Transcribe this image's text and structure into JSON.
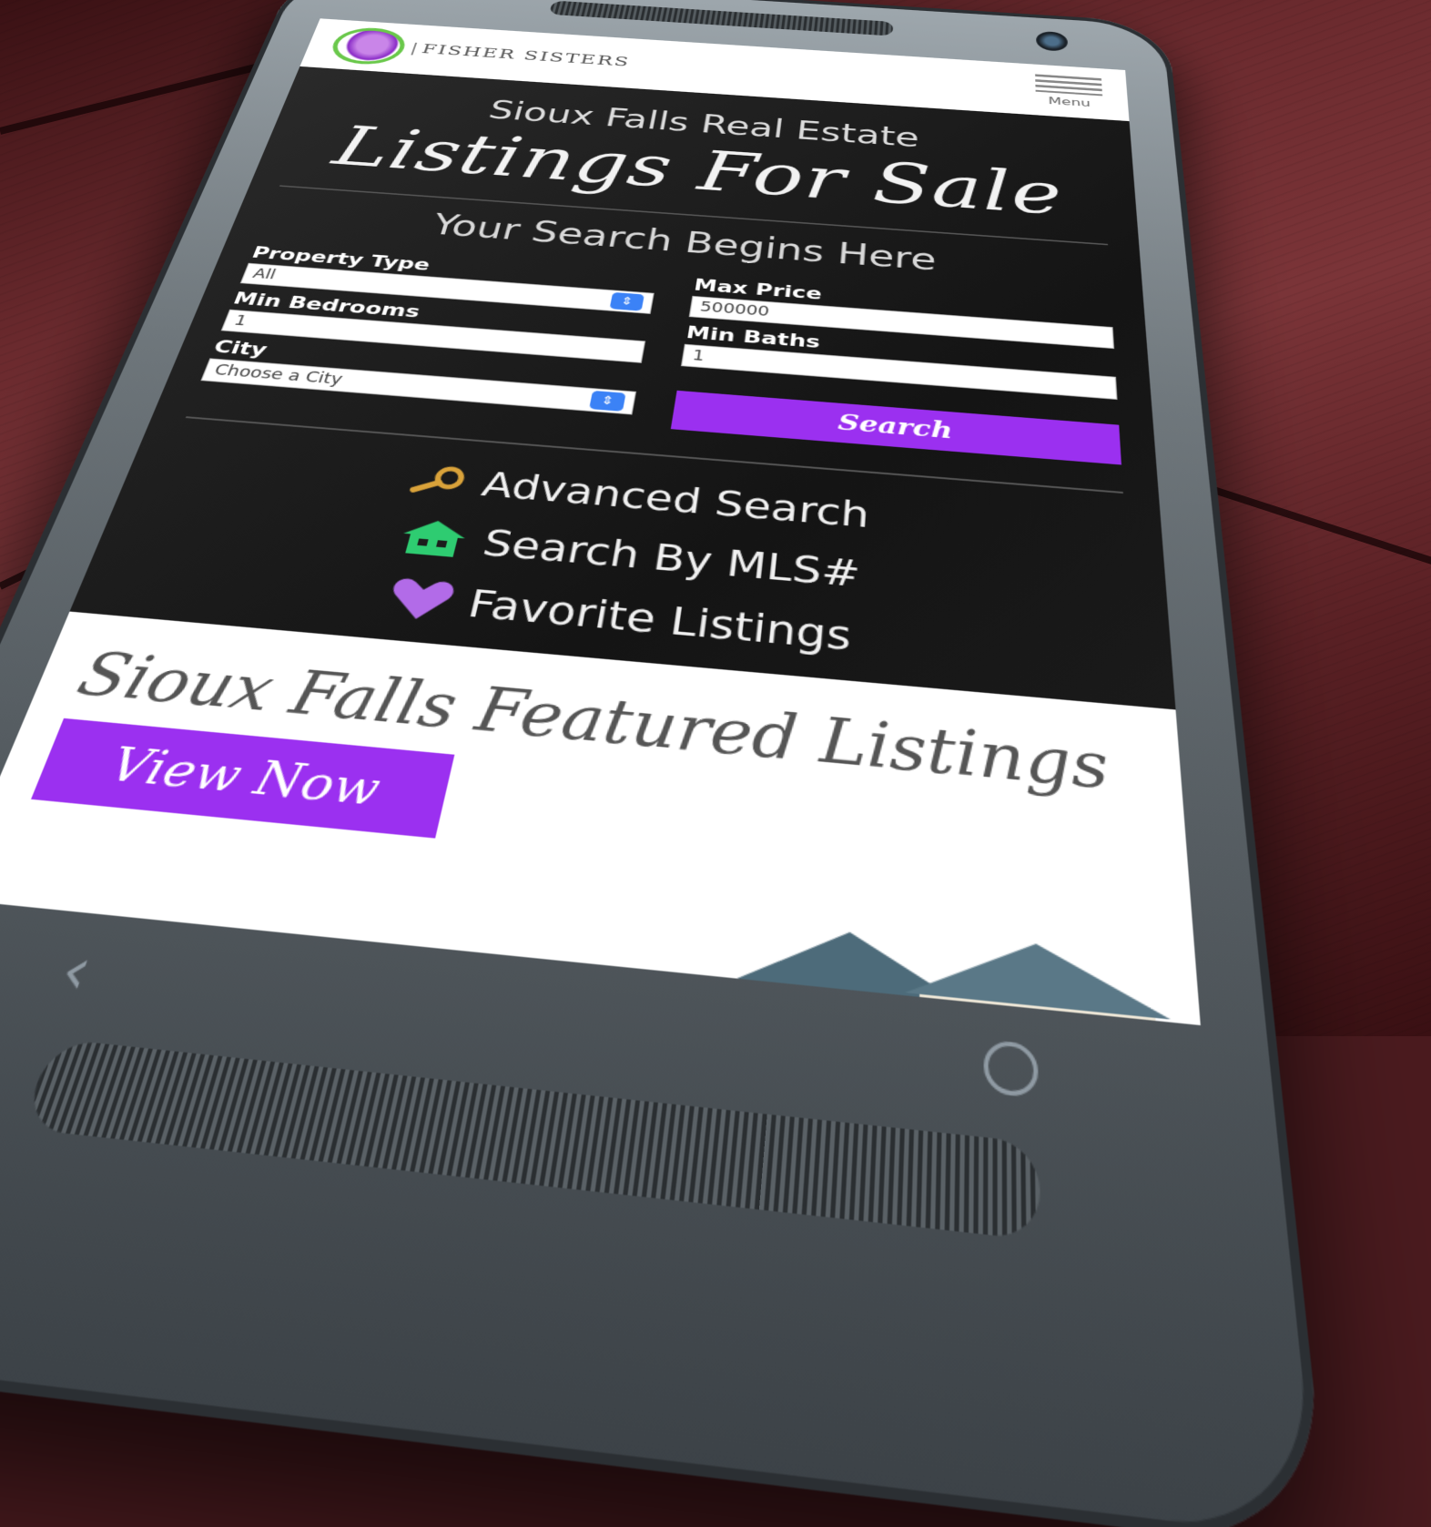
{
  "site": {
    "logo_text": "FISHER SISTERS",
    "menu_label": "Menu"
  },
  "hero": {
    "subtitle": "Sioux Falls Real Estate",
    "title": "Listings For Sale",
    "search_heading": "Your Search Begins Here"
  },
  "form": {
    "property_type": {
      "label": "Property Type",
      "value": "All"
    },
    "min_bedrooms": {
      "label": "Min Bedrooms",
      "value": "1"
    },
    "city": {
      "label": "City",
      "value": "Choose a City"
    },
    "max_price": {
      "label": "Max Price",
      "value": "500000"
    },
    "min_baths": {
      "label": "Min Baths",
      "value": "1"
    },
    "search_button": "Search"
  },
  "links": {
    "advanced_search": {
      "label": "Advanced Search",
      "icon": "search-icon",
      "color": "#d9a23a"
    },
    "search_by_mls": {
      "label": "Search By MLS#",
      "icon": "house-icon",
      "color": "#2ecc71"
    },
    "favorite_listings": {
      "label": "Favorite Listings",
      "icon": "heart-icon",
      "color": "#b26be8"
    }
  },
  "featured": {
    "title": "Sioux Falls Featured Listings",
    "button": "View Now"
  },
  "colors": {
    "accent": "#9b30f0",
    "hero_bg": "#1c1c1c"
  }
}
